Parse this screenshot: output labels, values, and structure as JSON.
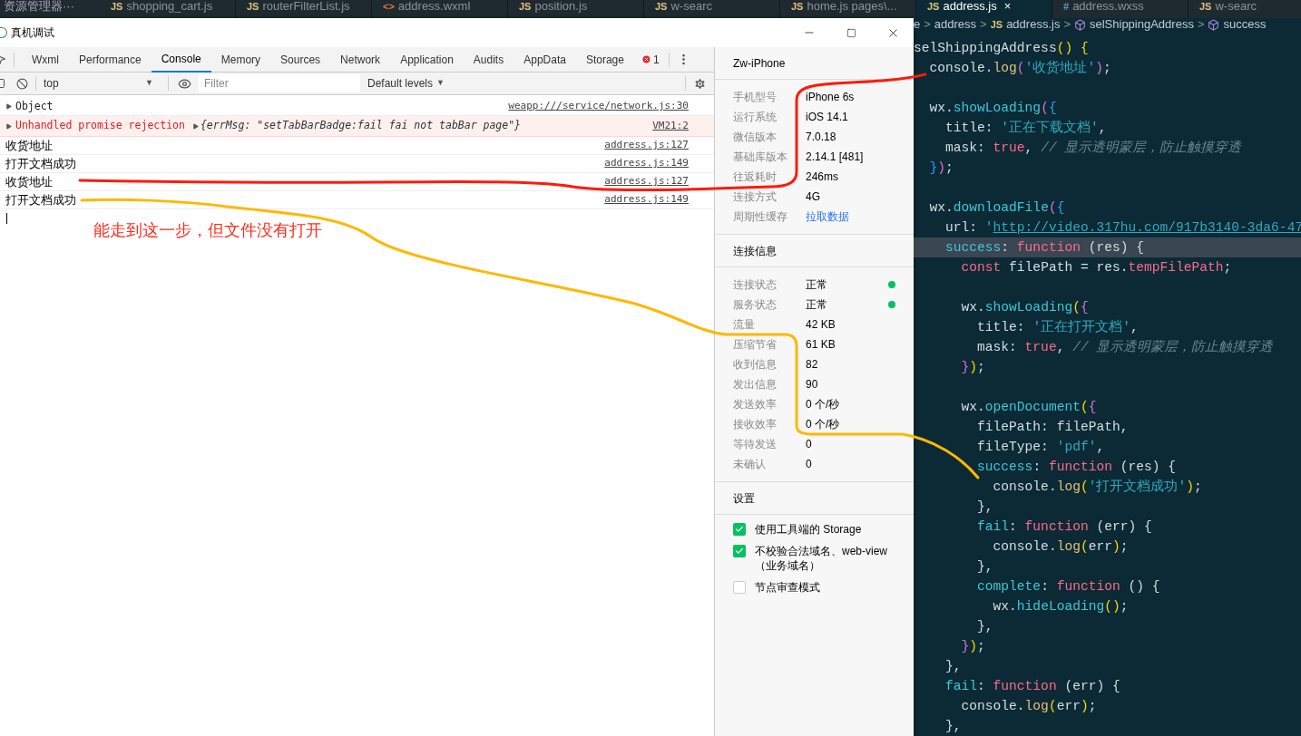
{
  "editor_tabs": {
    "explorer_title": "资源管理器",
    "more": "···",
    "tabs": [
      {
        "badge": "JS",
        "kind": "js",
        "label": "shopping_cart.js",
        "selected": false
      },
      {
        "badge": "JS",
        "kind": "js",
        "label": "routerFilterList.js",
        "selected": false
      },
      {
        "badge": "<>",
        "kind": "html",
        "label": "address.wxml",
        "selected": false
      },
      {
        "badge": "JS",
        "kind": "js",
        "label": "position.js",
        "selected": false
      },
      {
        "badge": "JS",
        "kind": "js",
        "label": "w-searc",
        "selected": false
      },
      {
        "badge": "JS",
        "kind": "js",
        "label": "home.js pages\\...",
        "selected": false
      },
      {
        "badge": "JS",
        "kind": "js",
        "label": "address.js",
        "selected": true,
        "close": "×"
      },
      {
        "badge": "#",
        "kind": "css",
        "label": "address.wxss",
        "selected": false
      },
      {
        "badge": "JS",
        "kind": "js",
        "label": "w-searc",
        "selected": false
      }
    ]
  },
  "devtools": {
    "title": "真机调试",
    "tabs": [
      {
        "label": "Wxml",
        "selected": false
      },
      {
        "label": "Performance",
        "selected": false
      },
      {
        "label": "Console",
        "selected": true
      },
      {
        "label": "Memory",
        "selected": false
      },
      {
        "label": "Sources",
        "selected": false
      },
      {
        "label": "Network",
        "selected": false
      },
      {
        "label": "Application",
        "selected": false
      },
      {
        "label": "Audits",
        "selected": false
      },
      {
        "label": "AppData",
        "selected": false
      },
      {
        "label": "Storage",
        "selected": false
      }
    ],
    "error_count": "1",
    "context": "top",
    "context_caret": "▼",
    "filter_placeholder": "Filter",
    "levels": "Default levels",
    "levels_caret": "▼",
    "console": [
      {
        "kind": "object",
        "text": "Object",
        "source": "weapp:///service/network.js:30"
      },
      {
        "kind": "error",
        "text": "Unhandled promise rejection",
        "detail": "{errMsg: \"setTabBarBadge:fail fai not tabBar page\"}",
        "source": "VM21:2"
      },
      {
        "kind": "log",
        "text": "收货地址",
        "source": "address.js:127"
      },
      {
        "kind": "log",
        "text": "打开文档成功",
        "source": "address.js:149"
      },
      {
        "kind": "log",
        "text": "收货地址",
        "source": "address.js:127"
      },
      {
        "kind": "log",
        "text": "打开文档成功",
        "source": "address.js:149"
      }
    ],
    "device": "Zw-iPhone",
    "device_info": [
      {
        "label": "手机型号",
        "value": "iPhone 6s",
        "kind": "text"
      },
      {
        "label": "运行系统",
        "value": "iOS 14.1",
        "kind": "text"
      },
      {
        "label": "微信版本",
        "value": "7.0.18",
        "kind": "text"
      },
      {
        "label": "基础库版本",
        "value": "2.14.1 [481]",
        "kind": "text"
      },
      {
        "label": "往返耗时",
        "value": "246ms",
        "kind": "text"
      },
      {
        "label": "连接方式",
        "value": "4G",
        "kind": "text"
      },
      {
        "label": "周期性缓存",
        "value": "拉取数据",
        "kind": "link"
      }
    ],
    "connection_title": "连接信息",
    "connection": [
      {
        "label": "连接状态",
        "value": "正常",
        "color": "#07c160"
      },
      {
        "label": "服务状态",
        "value": "正常",
        "color": "#07c160"
      },
      {
        "label": "流量",
        "value": "42 KB"
      },
      {
        "label": "压缩节省",
        "value": "61 KB"
      },
      {
        "label": "收到信息",
        "value": "82"
      },
      {
        "label": "发出信息",
        "value": "90"
      },
      {
        "label": "发送效率",
        "value": "0 个/秒"
      },
      {
        "label": "接收效率",
        "value": "0 个/秒"
      },
      {
        "label": "等待发送",
        "value": "0"
      },
      {
        "label": "未确认",
        "value": "0"
      }
    ],
    "settings_title": "设置",
    "settings": [
      {
        "label": "使用工具端的 Storage",
        "checked": true
      },
      {
        "label": "不校验合法域名、web-view（业务域名）",
        "checked": true
      },
      {
        "label": "节点审查模式",
        "checked": false
      }
    ]
  },
  "annotation": "能走到这一步，但文件没有打开",
  "breadcrumb": [
    {
      "kind": "text",
      "text": "e"
    },
    {
      "kind": "text",
      "text": "address"
    },
    {
      "kind": "js",
      "badge": "JS",
      "text": "address.js"
    },
    {
      "kind": "symbol",
      "text": "selShippingAddress"
    },
    {
      "kind": "symbol",
      "text": "success"
    }
  ],
  "breadcrumb_separator": ">",
  "code": [
    {
      "current": false,
      "tokens": [
        {
          "kind": "plain",
          "text": "selShippingAddress"
        },
        {
          "kind": "paren",
          "text": "() {"
        }
      ]
    },
    {
      "current": false,
      "tokens": [
        {
          "kind": "plain",
          "text": "  console."
        },
        {
          "kind": "method",
          "text": "log"
        },
        {
          "kind": "brace",
          "text": "("
        },
        {
          "kind": "string",
          "text": "'收货地址'"
        },
        {
          "kind": "brace",
          "text": ")"
        },
        {
          "kind": "plain",
          "text": ";"
        }
      ]
    },
    {
      "current": false
    },
    {
      "current": false,
      "tokens": [
        {
          "kind": "plain",
          "text": "  wx."
        },
        {
          "kind": "func",
          "text": "showLoading"
        },
        {
          "kind": "brace",
          "text": "("
        },
        {
          "kind": "bracket",
          "text": "{"
        }
      ]
    },
    {
      "current": false,
      "tokens": [
        {
          "kind": "plain",
          "text": "    title: "
        },
        {
          "kind": "string",
          "text": "'正在下载文档'"
        },
        {
          "kind": "plain",
          "text": ","
        }
      ]
    },
    {
      "current": false,
      "tokens": [
        {
          "kind": "plain",
          "text": "    mask: "
        },
        {
          "kind": "keyword",
          "text": "true"
        },
        {
          "kind": "plain",
          "text": ", "
        },
        {
          "kind": "comment",
          "text": "// 显示透明蒙层，防止触摸穿透"
        }
      ]
    },
    {
      "current": false,
      "tokens": [
        {
          "kind": "bracket",
          "text": "  }"
        },
        {
          "kind": "brace",
          "text": ")"
        },
        {
          "kind": "plain",
          "text": ";"
        }
      ]
    },
    {
      "current": false
    },
    {
      "current": false,
      "tokens": [
        {
          "kind": "plain",
          "text": "  wx."
        },
        {
          "kind": "func",
          "text": "downloadFile"
        },
        {
          "kind": "brace",
          "text": "("
        },
        {
          "kind": "bracket",
          "text": "{"
        }
      ]
    },
    {
      "current": false,
      "tokens": [
        {
          "kind": "plain",
          "text": "    url: "
        },
        {
          "kind": "string",
          "text": "'"
        },
        {
          "kind": "url",
          "text": "http://video.317hu.com/917b3140-3da6-47"
        }
      ]
    },
    {
      "current": true,
      "tokens": [
        {
          "kind": "key",
          "text": "    success"
        },
        {
          "kind": "plain",
          "text": ": "
        },
        {
          "kind": "keyword",
          "text": "function"
        },
        {
          "kind": "plain",
          "text": " (res) {"
        }
      ]
    },
    {
      "current": false,
      "tokens": [
        {
          "kind": "keyword",
          "text": "      const"
        },
        {
          "kind": "plain",
          "text": " filePath = res."
        },
        {
          "kind": "keyword",
          "text": "tempFilePath"
        },
        {
          "kind": "plain",
          "text": ";"
        }
      ]
    },
    {
      "current": false
    },
    {
      "current": false,
      "tokens": [
        {
          "kind": "plain",
          "text": "      wx."
        },
        {
          "kind": "func",
          "text": "showLoading"
        },
        {
          "kind": "paren",
          "text": "("
        },
        {
          "kind": "brace",
          "text": "{"
        }
      ]
    },
    {
      "current": false,
      "tokens": [
        {
          "kind": "plain",
          "text": "        title: "
        },
        {
          "kind": "string",
          "text": "'正在打开文档'"
        },
        {
          "kind": "plain",
          "text": ","
        }
      ]
    },
    {
      "current": false,
      "tokens": [
        {
          "kind": "plain",
          "text": "        mask: "
        },
        {
          "kind": "keyword",
          "text": "true"
        },
        {
          "kind": "plain",
          "text": ", "
        },
        {
          "kind": "comment",
          "text": "// 显示透明蒙层，防止触摸穿透"
        }
      ]
    },
    {
      "current": false,
      "tokens": [
        {
          "kind": "brace",
          "text": "      }"
        },
        {
          "kind": "paren",
          "text": ")"
        },
        {
          "kind": "plain",
          "text": ";"
        }
      ]
    },
    {
      "current": false
    },
    {
      "current": false,
      "tokens": [
        {
          "kind": "plain",
          "text": "      wx."
        },
        {
          "kind": "func",
          "text": "openDocument"
        },
        {
          "kind": "paren",
          "text": "("
        },
        {
          "kind": "brace",
          "text": "{"
        }
      ]
    },
    {
      "current": false,
      "tokens": [
        {
          "kind": "plain",
          "text": "        filePath: filePath,"
        }
      ]
    },
    {
      "current": false,
      "tokens": [
        {
          "kind": "plain",
          "text": "        fileType: "
        },
        {
          "kind": "string",
          "text": "'pdf'"
        },
        {
          "kind": "plain",
          "text": ","
        }
      ]
    },
    {
      "current": false,
      "tokens": [
        {
          "kind": "key",
          "text": "        success"
        },
        {
          "kind": "plain",
          "text": ": "
        },
        {
          "kind": "keyword",
          "text": "function"
        },
        {
          "kind": "plain",
          "text": " (res) {"
        }
      ]
    },
    {
      "current": false,
      "tokens": [
        {
          "kind": "plain",
          "text": "          console."
        },
        {
          "kind": "method",
          "text": "log"
        },
        {
          "kind": "paren",
          "text": "("
        },
        {
          "kind": "string",
          "text": "'打开文档成功'"
        },
        {
          "kind": "paren",
          "text": ")"
        },
        {
          "kind": "plain",
          "text": ";"
        }
      ]
    },
    {
      "current": false,
      "tokens": [
        {
          "kind": "plain",
          "text": "        },"
        }
      ]
    },
    {
      "current": false,
      "tokens": [
        {
          "kind": "key",
          "text": "        fail"
        },
        {
          "kind": "plain",
          "text": ": "
        },
        {
          "kind": "keyword",
          "text": "function"
        },
        {
          "kind": "plain",
          "text": " (err) {"
        }
      ]
    },
    {
      "current": false,
      "tokens": [
        {
          "kind": "plain",
          "text": "          console."
        },
        {
          "kind": "method",
          "text": "log"
        },
        {
          "kind": "paren",
          "text": "("
        },
        {
          "kind": "plain",
          "text": "err"
        },
        {
          "kind": "paren",
          "text": ")"
        },
        {
          "kind": "plain",
          "text": ";"
        }
      ]
    },
    {
      "current": false,
      "tokens": [
        {
          "kind": "plain",
          "text": "        },"
        }
      ]
    },
    {
      "current": false,
      "tokens": [
        {
          "kind": "key",
          "text": "        complete"
        },
        {
          "kind": "plain",
          "text": ": "
        },
        {
          "kind": "keyword",
          "text": "function"
        },
        {
          "kind": "plain",
          "text": " () {"
        }
      ]
    },
    {
      "current": false,
      "tokens": [
        {
          "kind": "plain",
          "text": "          wx."
        },
        {
          "kind": "func",
          "text": "hideLoading"
        },
        {
          "kind": "paren",
          "text": "()"
        },
        {
          "kind": "plain",
          "text": ";"
        }
      ]
    },
    {
      "current": false,
      "tokens": [
        {
          "kind": "plain",
          "text": "        },"
        }
      ]
    },
    {
      "current": false,
      "tokens": [
        {
          "kind": "brace",
          "text": "      }"
        },
        {
          "kind": "paren",
          "text": ")"
        },
        {
          "kind": "plain",
          "text": ";"
        }
      ]
    },
    {
      "current": false,
      "tokens": [
        {
          "kind": "plain",
          "text": "    },"
        }
      ]
    },
    {
      "current": false,
      "tokens": [
        {
          "kind": "key",
          "text": "    fail"
        },
        {
          "kind": "plain",
          "text": ": "
        },
        {
          "kind": "keyword",
          "text": "function"
        },
        {
          "kind": "plain",
          "text": " (err) {"
        }
      ]
    },
    {
      "current": false,
      "tokens": [
        {
          "kind": "plain",
          "text": "      console."
        },
        {
          "kind": "method",
          "text": "log"
        },
        {
          "kind": "paren",
          "text": "("
        },
        {
          "kind": "plain",
          "text": "err"
        },
        {
          "kind": "paren",
          "text": ")"
        },
        {
          "kind": "plain",
          "text": ";"
        }
      ]
    },
    {
      "current": false,
      "tokens": [
        {
          "kind": "plain",
          "text": "    },"
        }
      ]
    }
  ]
}
